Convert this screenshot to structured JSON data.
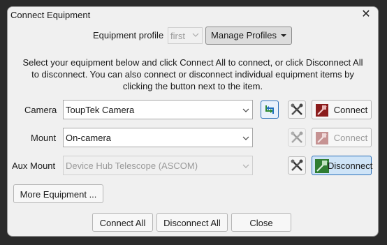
{
  "window": {
    "title": "Connect Equipment"
  },
  "profile": {
    "label": "Equipment profile",
    "value": "first",
    "manage_label": "Manage Profiles"
  },
  "instructions": "Select your equipment below and click Connect All to connect, or click Disconnect All to disconnect. You can also connect or disconnect individual equipment items by clicking the button next to the item.",
  "rows": [
    {
      "label": "Camera",
      "value": "ToupTek Camera",
      "action": "Connect"
    },
    {
      "label": "Mount",
      "value": "On-camera",
      "action": "Connect"
    },
    {
      "label": "Aux Mount",
      "value": "Device Hub Telescope (ASCOM)",
      "action": "Disconnect"
    }
  ],
  "more_label": "More Equipment ...",
  "footer": {
    "connect_all": "Connect All",
    "disconnect_all": "Disconnect All",
    "close": "Close"
  },
  "icons": {
    "swap": "swap-arrows-icon",
    "tools": "tools-icon",
    "plug": "plug-icon"
  },
  "colors": {
    "accent": "#2f7d32",
    "highlight": "#cfe4f7"
  }
}
